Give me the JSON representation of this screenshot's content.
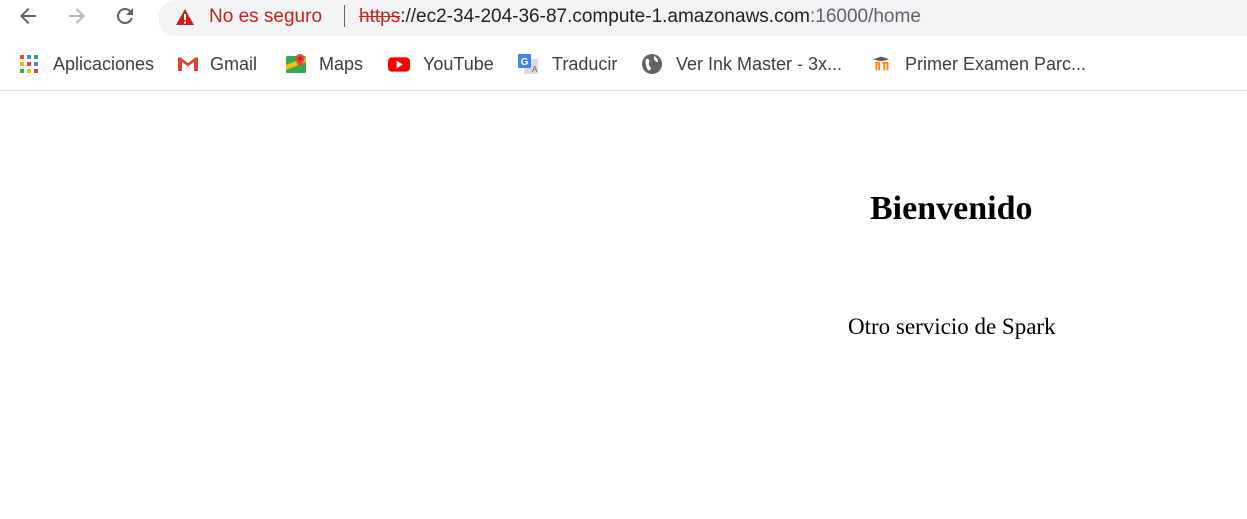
{
  "toolbar": {
    "back_icon": "arrow-left-icon",
    "forward_icon": "arrow-right-icon",
    "reload_icon": "reload-icon"
  },
  "omnibox": {
    "warning_icon": "warning-triangle-icon",
    "security_label": "No es seguro",
    "url_scheme": "https",
    "url_host": "://ec2-34-204-36-87.compute-1.amazonaws.com",
    "url_path": ":16000/home",
    "warning_color": "#c5221f"
  },
  "bookmarks": [
    {
      "label": "Aplicaciones",
      "icon": "apps-grid-icon"
    },
    {
      "label": "Gmail",
      "icon": "gmail-icon"
    },
    {
      "label": "Maps",
      "icon": "maps-icon"
    },
    {
      "label": "YouTube",
      "icon": "youtube-icon"
    },
    {
      "label": "Traducir",
      "icon": "translate-icon"
    },
    {
      "label": "Ver Ink Master - 3x...",
      "icon": "globe-icon"
    },
    {
      "label": "Primer Examen Parc...",
      "icon": "moodle-icon"
    }
  ],
  "page": {
    "heading": "Bienvenido",
    "text": "Otro servicio de Spark"
  }
}
